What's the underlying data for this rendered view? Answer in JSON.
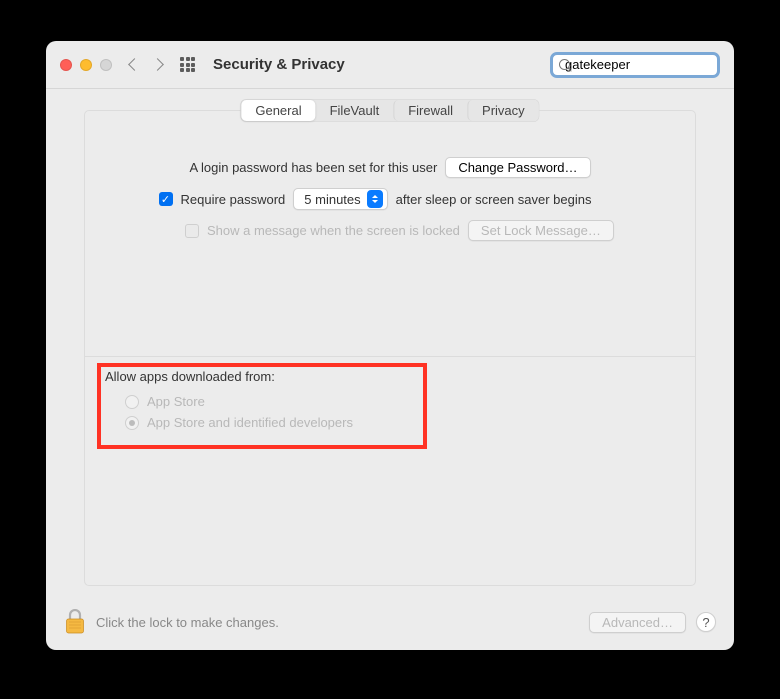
{
  "window": {
    "title": "Security & Privacy"
  },
  "search": {
    "value": "gatekeeper",
    "placeholder": "Search"
  },
  "tabs": [
    {
      "label": "General",
      "active": true
    },
    {
      "label": "FileVault",
      "active": false
    },
    {
      "label": "Firewall",
      "active": false
    },
    {
      "label": "Privacy",
      "active": false
    }
  ],
  "login": {
    "password_set_text": "A login password has been set for this user",
    "change_password_label": "Change Password…",
    "require_password_label": "Require password",
    "require_password_checked": true,
    "delay_value": "5 minutes",
    "after_sleep_text": "after sleep or screen saver begins",
    "show_message_label": "Show a message when the screen is locked",
    "show_message_checked": false,
    "set_lock_message_label": "Set Lock Message…"
  },
  "gatekeeper": {
    "heading": "Allow apps downloaded from:",
    "options": [
      {
        "label": "App Store",
        "selected": false
      },
      {
        "label": "App Store and identified developers",
        "selected": true
      }
    ]
  },
  "footer": {
    "lock_text": "Click the lock to make changes.",
    "advanced_label": "Advanced…"
  }
}
